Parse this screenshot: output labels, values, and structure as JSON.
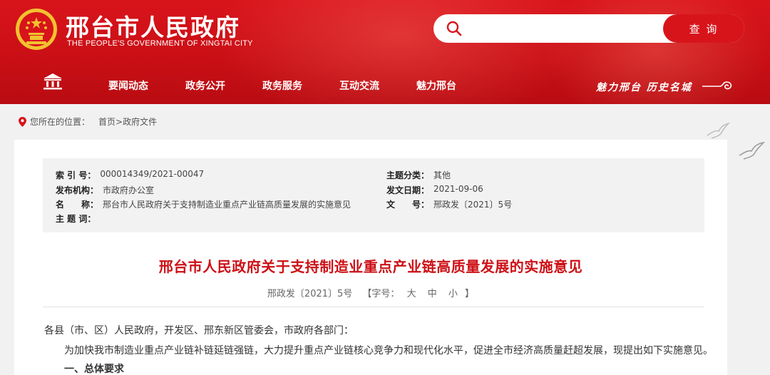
{
  "header": {
    "title": "邢台市人民政府",
    "subtitle": "THE PEOPLE'S GOVERNMENT OF XINGTAI CITY",
    "search_placeholder": "",
    "search_button": "查 询",
    "slogan": "魅力邢台 历史名城"
  },
  "nav": {
    "items": [
      "要闻动态",
      "政务公开",
      "政务服务",
      "互动交流",
      "魅力邢台"
    ]
  },
  "breadcrumb": {
    "prefix": "您所在的位置：",
    "home": "首页",
    "sep": ">",
    "current": "政府文件"
  },
  "meta": {
    "index_label": "索 引 号：",
    "index_value": "000014349/2021-00047",
    "org_label": "发布机构：",
    "org_value": "市政府办公室",
    "name_label": "名　　称：",
    "name_value": "邢台市人民政府关于支持制造业重点产业链高质量发展的实施意见",
    "keywords_label": "主 题 词：",
    "keywords_value": "",
    "category_label": "主题分类：",
    "category_value": "其他",
    "date_label": "发文日期：",
    "date_value": "2021-09-06",
    "docno_label": "文　　号：",
    "docno_value": "邢政发〔2021〕5号"
  },
  "doc": {
    "title": "邢台市人民政府关于支持制造业重点产业链高质量发展的实施意见",
    "number": "邢政发〔2021〕5号",
    "font_prefix": "【字号：",
    "font_large": "大",
    "font_medium": "中",
    "font_small": "小",
    "font_suffix": "】",
    "salutation": "各县（市、区）人民政府，开发区、邢东新区管委会，市政府各部门：",
    "intro": "为加快我市制造业重点产业链补链延链强链，大力提升重点产业链核心竞争力和现代化水平，促进全市经济高质量赶超发展，现提出如下实施意见。",
    "section1": "一、总体要求"
  },
  "colors": {
    "brand_red": "#d8141b",
    "title_red": "#cc1016"
  }
}
